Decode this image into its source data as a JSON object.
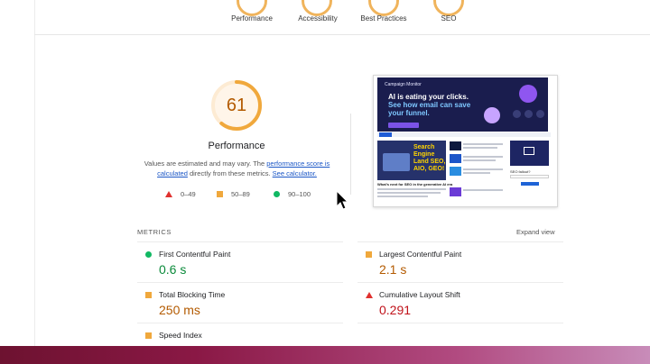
{
  "categories": [
    {
      "label": "Performance"
    },
    {
      "label": "Accessibility"
    },
    {
      "label": "Best Practices"
    },
    {
      "label": "SEO"
    }
  ],
  "score": {
    "value": "61",
    "fraction": 0.61,
    "title": "Performance",
    "ring_color": "#f0a83c"
  },
  "description": {
    "part1": "Values are estimated and may vary. The ",
    "link1": "performance score is calculated",
    "part2": " directly from these metrics. ",
    "link2": "See calculator."
  },
  "legend": [
    {
      "shape": "triangle",
      "label": "0–49",
      "color": "#e0312f"
    },
    {
      "shape": "square",
      "label": "50–89",
      "color": "#f0a83c"
    },
    {
      "shape": "circle",
      "label": "90–100",
      "color": "#11b863"
    }
  ],
  "screenshot": {
    "brand": "Campaign Monitor",
    "headline": "AI is eating your clicks.",
    "subhead": "See how email can save your funnel.",
    "card_text": "Search Engine Land SEO, AIO, GEO!",
    "side_text": "SEO fallout?",
    "article_title": "What's next for SEO in the generative AI era"
  },
  "metrics": {
    "header": "METRICS",
    "expand_label": "Expand view",
    "items": [
      {
        "name": "First Contentful Paint",
        "value": "0.6 s",
        "status": "good"
      },
      {
        "name": "Largest Contentful Paint",
        "value": "2.1 s",
        "status": "average"
      },
      {
        "name": "Total Blocking Time",
        "value": "250 ms",
        "status": "average"
      },
      {
        "name": "Cumulative Layout Shift",
        "value": "0.291",
        "status": "poor"
      },
      {
        "name": "Speed Index",
        "value": "",
        "status": "average"
      }
    ]
  }
}
